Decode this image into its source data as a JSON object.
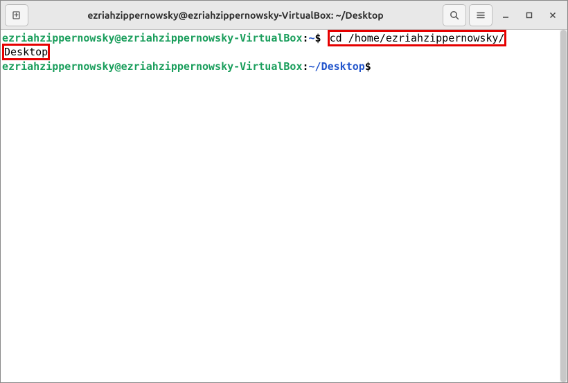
{
  "titlebar": {
    "title": "ezriahzippernowsky@ezriahzippernowsky-VirtualBox: ~/Desktop"
  },
  "terminal": {
    "line1": {
      "userhost": "ezriahzippernowsky@ezriahzippernowsky-VirtualBox",
      "colon": ":",
      "path": "~",
      "dollar": "$",
      "command_part1": "cd /home/ezriahzippernowsky/",
      "command_part2": "Desktop"
    },
    "line2": {
      "userhost": "ezriahzippernowsky@ezriahzippernowsky-VirtualBox",
      "colon": ":",
      "path": "~/Desktop",
      "dollar": "$"
    }
  }
}
